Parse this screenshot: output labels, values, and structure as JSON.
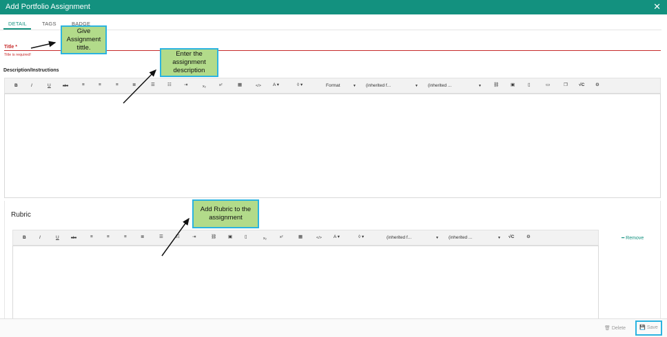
{
  "window": {
    "title": "Add Portfolio Assignment",
    "close_icon": "close-icon"
  },
  "tabs": [
    {
      "label": "DETAIL",
      "active": true
    },
    {
      "label": "TAGS",
      "active": false
    },
    {
      "label": "BADGE",
      "active": false
    }
  ],
  "title_field": {
    "label": "Title *",
    "error": "Title is required!"
  },
  "description": {
    "label": "Description/Instructions",
    "toolbar": {
      "format_label": "Format",
      "font_family_label": "(inherited f...",
      "font_size_label": "(inherited ..."
    }
  },
  "rubric": {
    "heading": "Rubric",
    "remove_label": "Remove",
    "toolbar": {
      "font_family_label": "(inherited f...",
      "font_size_label": "(inherited ..."
    }
  },
  "footer": {
    "delete_label": "Delete",
    "save_label": "Save"
  },
  "annotations": {
    "title_hint": "Give Assignment tittle.",
    "description_hint": "Enter the assignment description",
    "rubric_hint": "Add Rubric to the assignment"
  },
  "colors": {
    "accent": "#13917f",
    "error": "#c62828",
    "callout_fill": "#b2db8a",
    "callout_border": "#2ab3e0"
  }
}
